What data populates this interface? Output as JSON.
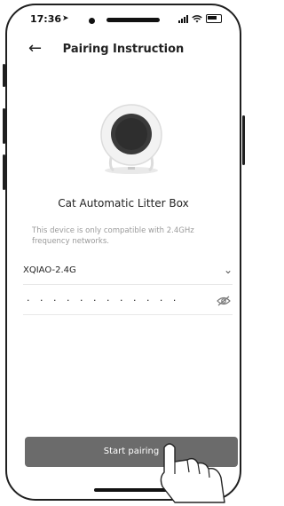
{
  "status_bar": {
    "time": "17:36",
    "location_icon": "location-arrow-icon",
    "signal_icon": "cellular-signal-icon",
    "wifi_icon": "wifi-icon",
    "battery_icon": "battery-icon"
  },
  "header": {
    "back_icon": "back-arrow-icon",
    "title": "Pairing Instruction"
  },
  "device": {
    "image_icon": "litter-box-device-icon",
    "name": "Cat Automatic Litter Box"
  },
  "hint": "This device is only compatible with 2.4GHz frequency networks.",
  "wifi_field": {
    "value": "XQIAO-2.4G",
    "dropdown_icon": "chevron-down-icon"
  },
  "password_field": {
    "masked_value": "· · · · · · · · · · · ·",
    "visibility_icon": "eye-off-icon"
  },
  "start_button": {
    "label": "Start pairing"
  },
  "colors": {
    "button_bg": "#6b6b6b",
    "hint_text": "#9a9a9a",
    "device_body": "#f2f2f2",
    "device_door": "#3a3a3a"
  }
}
